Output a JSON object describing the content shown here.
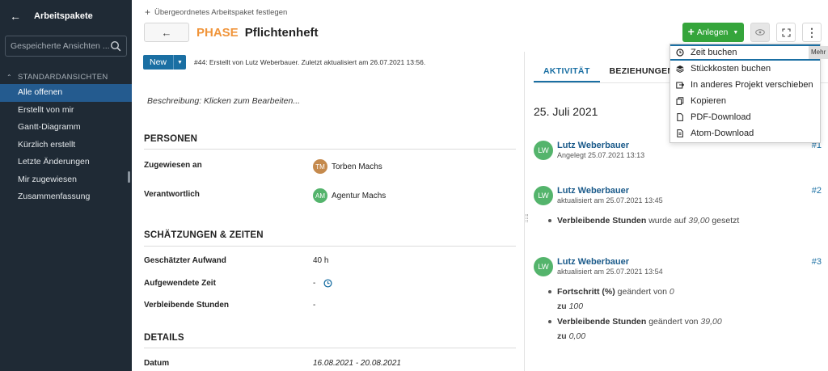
{
  "sidebar": {
    "title": "Arbeitspakete",
    "search_placeholder": "Gespeicherte Ansichten ...",
    "section_label": "STANDARDANSICHTEN",
    "items": [
      {
        "label": "Alle offenen"
      },
      {
        "label": "Erstellt von mir"
      },
      {
        "label": "Gantt-Diagramm"
      },
      {
        "label": "Kürzlich erstellt"
      },
      {
        "label": "Letzte Änderungen"
      },
      {
        "label": "Mir zugewiesen"
      },
      {
        "label": "Zusammenfassung"
      }
    ]
  },
  "header": {
    "parent_link": "Übergeordnetes Arbeitspaket festlegen",
    "type": "PHASE",
    "subject": "Pflichtenheft",
    "create_label": "Anlegen",
    "tooltip": "Mehr"
  },
  "status": {
    "label": "New",
    "info": "#44: Erstellt von Lutz Weberbauer. Zuletzt aktualisiert am 26.07.2021 13:56."
  },
  "description": "Beschreibung: Klicken zum Bearbeiten...",
  "sections": {
    "personen": {
      "title": "PERSONEN",
      "assignee_label": "Zugewiesen an",
      "assignee_initials": "TM",
      "assignee_name": "Torben Machs",
      "responsible_label": "Verantwortlich",
      "responsible_initials": "AM",
      "responsible_name": "Agentur Machs"
    },
    "zeiten": {
      "title": "SCHÄTZUNGEN & ZEITEN",
      "estimated_label": "Geschätzter Aufwand",
      "estimated_value": "40 h",
      "spent_label": "Aufgewendete Zeit",
      "spent_value": "-",
      "remaining_label": "Verbleibende Stunden",
      "remaining_value": "-"
    },
    "details": {
      "title": "DETAILS",
      "date_label": "Datum",
      "date_value": "16.08.2021 - 20.08.2021"
    }
  },
  "tabs": [
    {
      "label": "AKTIVITÄT"
    },
    {
      "label": "BEZIEHUNGEN"
    }
  ],
  "activity": {
    "date": "25. Juli 2021",
    "entries": [
      {
        "initials": "LW",
        "name": "Lutz Weberbauer",
        "meta": "Angelegt 25.07.2021 13:13",
        "num": "#1"
      },
      {
        "initials": "LW",
        "name": "Lutz Weberbauer",
        "meta": "aktualisiert am 25.07.2021 13:45",
        "num": "#2",
        "d1_field": "Verbleibende Stunden",
        "d1_text": " wurde auf ",
        "d1_val": "39,00",
        "d1_end": " gesetzt"
      },
      {
        "initials": "LW",
        "name": "Lutz Weberbauer",
        "meta": "aktualisiert am 25.07.2021 13:54",
        "num": "#3",
        "d1_field": "Fortschritt (%)",
        "d1_text": " geändert von ",
        "d1_val": "0",
        "d1_to": "zu",
        "d1_new": "100",
        "d2_field": "Verbleibende Stunden",
        "d2_text": " geändert von ",
        "d2_val": "39,00",
        "d2_to": "zu",
        "d2_new": "0,00"
      }
    ]
  },
  "menu": {
    "items": [
      {
        "label": "Zeit buchen",
        "icon": "clock-icon"
      },
      {
        "label": "Stückkosten buchen",
        "icon": "stack-icon"
      },
      {
        "label": "In anderes Projekt verschieben",
        "icon": "move-icon"
      },
      {
        "label": "Kopieren",
        "icon": "copy-icon"
      },
      {
        "label": "PDF-Download",
        "icon": "file-icon"
      },
      {
        "label": "Atom-Download",
        "icon": "atom-file-icon"
      }
    ]
  },
  "colors": {
    "sidebar_bg": "#1f2a35",
    "sidebar_active": "#245b8f",
    "primary": "#1a6fa3",
    "create_green": "#35a53b",
    "phase_orange": "#f0953b",
    "avatar_green": "#54b46c",
    "avatar_tm": "#c58a4d"
  }
}
